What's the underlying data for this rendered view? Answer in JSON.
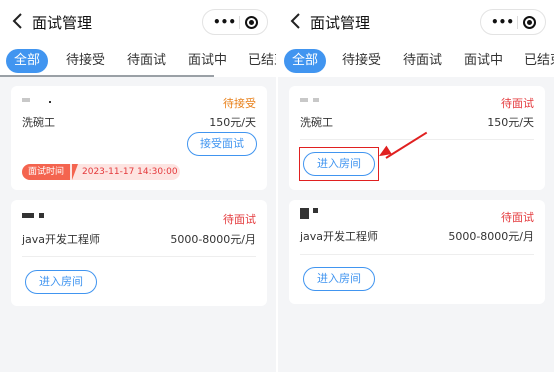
{
  "navbar": {
    "back_icon": "chevron-left-icon",
    "title": "面试管理",
    "more_icon": "more-dots-icon",
    "more_glyph": "•••",
    "target_icon": "target-icon"
  },
  "tabs": [
    "全部",
    "待接受",
    "待面试",
    "面试中",
    "已结束"
  ],
  "left": {
    "card1": {
      "status": "待接受",
      "job": "洗碗工",
      "salary": "150元/天",
      "button": "接受面试",
      "time_label": "面试时间",
      "time_value": "2023-11-17 14:30:00"
    },
    "card2": {
      "status": "待面试",
      "job": "java开发工程师",
      "salary": "5000-8000元/月",
      "button": "进入房间"
    }
  },
  "right": {
    "card1": {
      "status": "待面试",
      "job": "洗碗工",
      "salary": "150元/天",
      "button": "进入房间"
    },
    "card2": {
      "status": "待面试",
      "job": "java开发工程师",
      "salary": "5000-8000元/月",
      "button": "进入房间"
    }
  },
  "colors": {
    "accent": "#4195f0",
    "pending_accept": "#e8801a",
    "pending_interview": "#e4393c",
    "annotation": "#e02020"
  }
}
